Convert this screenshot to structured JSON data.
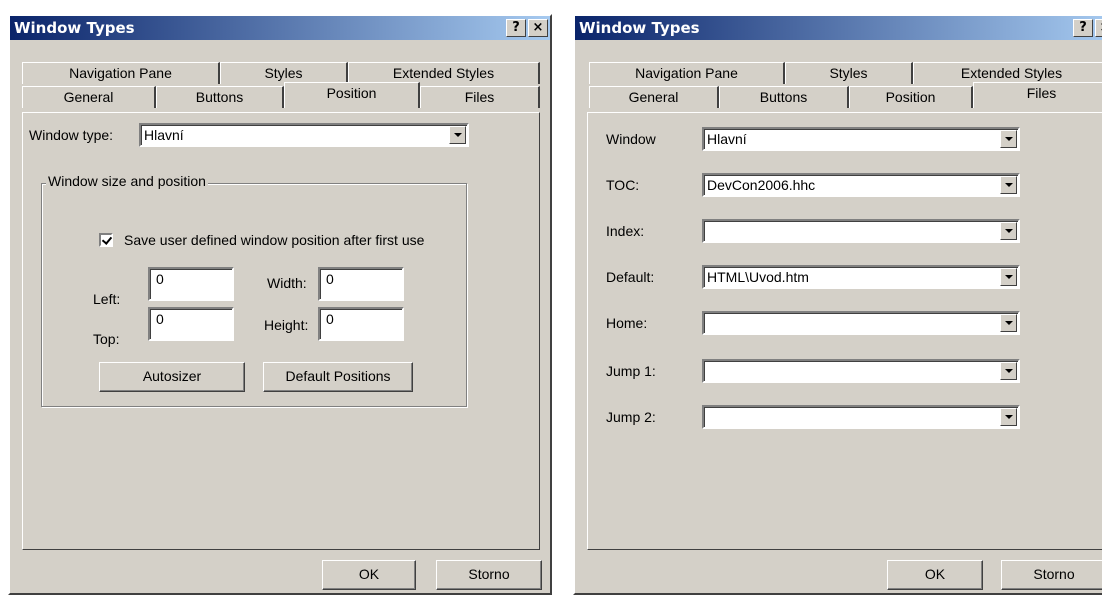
{
  "left_window": {
    "title": "Window Types",
    "help_button": "?",
    "close_button": "×",
    "tabs_row1": [
      "Navigation Pane",
      "Styles",
      "Extended Styles"
    ],
    "tabs_row2": [
      "General",
      "Buttons",
      "Position",
      "Files"
    ],
    "active_tab": "Position",
    "window_type_label": "Window type:",
    "window_type_value": "Hlavní",
    "group_title": "Window size and position",
    "save_position_label": "Save user defined window position after first use",
    "save_position_checked": true,
    "left_label": "Left:",
    "left_value": "0",
    "top_label": "Top:",
    "top_value": "0",
    "width_label": "Width:",
    "width_value": "0",
    "height_label": "Height:",
    "height_value": "0",
    "autosizer_label": "Autosizer",
    "default_positions_label": "Default Positions",
    "ok_label": "OK",
    "cancel_label": "Storno"
  },
  "right_window": {
    "title": "Window Types",
    "help_button": "?",
    "close_button": "×",
    "tabs_row1": [
      "Navigation Pane",
      "Styles",
      "Extended Styles"
    ],
    "tabs_row2": [
      "General",
      "Buttons",
      "Position",
      "Files"
    ],
    "active_tab": "Files",
    "fields": [
      {
        "label": "Window",
        "value": "Hlavní"
      },
      {
        "label": "TOC:",
        "value": "DevCon2006.hhc"
      },
      {
        "label": "Index:",
        "value": ""
      },
      {
        "label": "Default:",
        "value": "HTML\\Uvod.htm"
      },
      {
        "label": "Home:",
        "value": ""
      },
      {
        "label": "Jump 1:",
        "value": ""
      },
      {
        "label": "Jump 2:",
        "value": ""
      }
    ],
    "ok_label": "OK",
    "cancel_label": "Storno"
  },
  "colors": {
    "dialog_face": "#d4d0c8",
    "titlebar_start": "#0a246a",
    "titlebar_end": "#a6caf0"
  }
}
